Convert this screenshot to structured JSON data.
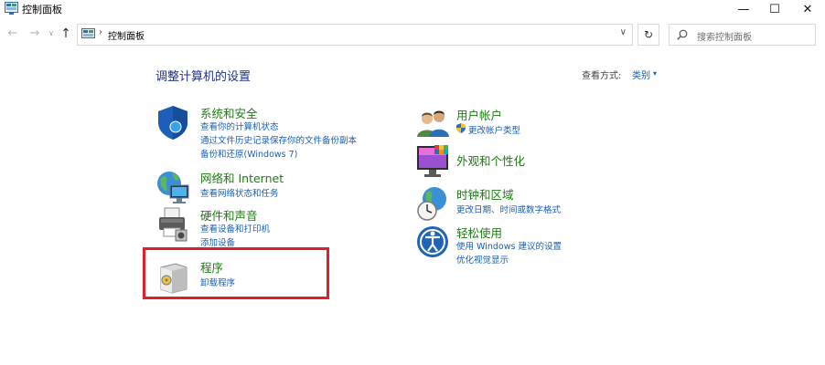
{
  "window": {
    "title": "控制面板",
    "min": "—",
    "max": "☐",
    "close": "✕"
  },
  "nav": {
    "back": "←",
    "forward": "→",
    "recent": "∨",
    "up": "↑",
    "separator": "›",
    "breadcrumb": "控制面板",
    "dropdown": "∨",
    "refresh": "↻"
  },
  "search": {
    "placeholder": "搜索控制面板"
  },
  "main": {
    "title": "调整计算机的设置",
    "view_by_label": "查看方式:",
    "view_by_value": "类别",
    "view_by_caret": "▾"
  },
  "left_categories": [
    {
      "title": "系统和安全",
      "links": [
        "查看你的计算机状态",
        "通过文件历史记录保存你的文件备份副本",
        "备份和还原(Windows 7)"
      ]
    },
    {
      "title": "网络和 Internet",
      "links": [
        "查看网络状态和任务"
      ]
    },
    {
      "title": "硬件和声音",
      "links": [
        "查看设备和打印机",
        "添加设备"
      ]
    },
    {
      "title": "程序",
      "links": [
        "卸载程序"
      ]
    }
  ],
  "right_categories": [
    {
      "title": "用户帐户",
      "links": [
        "更改帐户类型"
      ]
    },
    {
      "title": "外观和个性化",
      "links": []
    },
    {
      "title": "时钟和区域",
      "links": [
        "更改日期、时间或数字格式"
      ]
    },
    {
      "title": "轻松使用",
      "links": [
        "使用 Windows 建议的设置",
        "优化视觉显示"
      ]
    }
  ],
  "colors": {
    "category_title": "#1e7a13",
    "link": "#1a5fb4",
    "heading": "#1e3287",
    "highlight": "#e41e26"
  }
}
